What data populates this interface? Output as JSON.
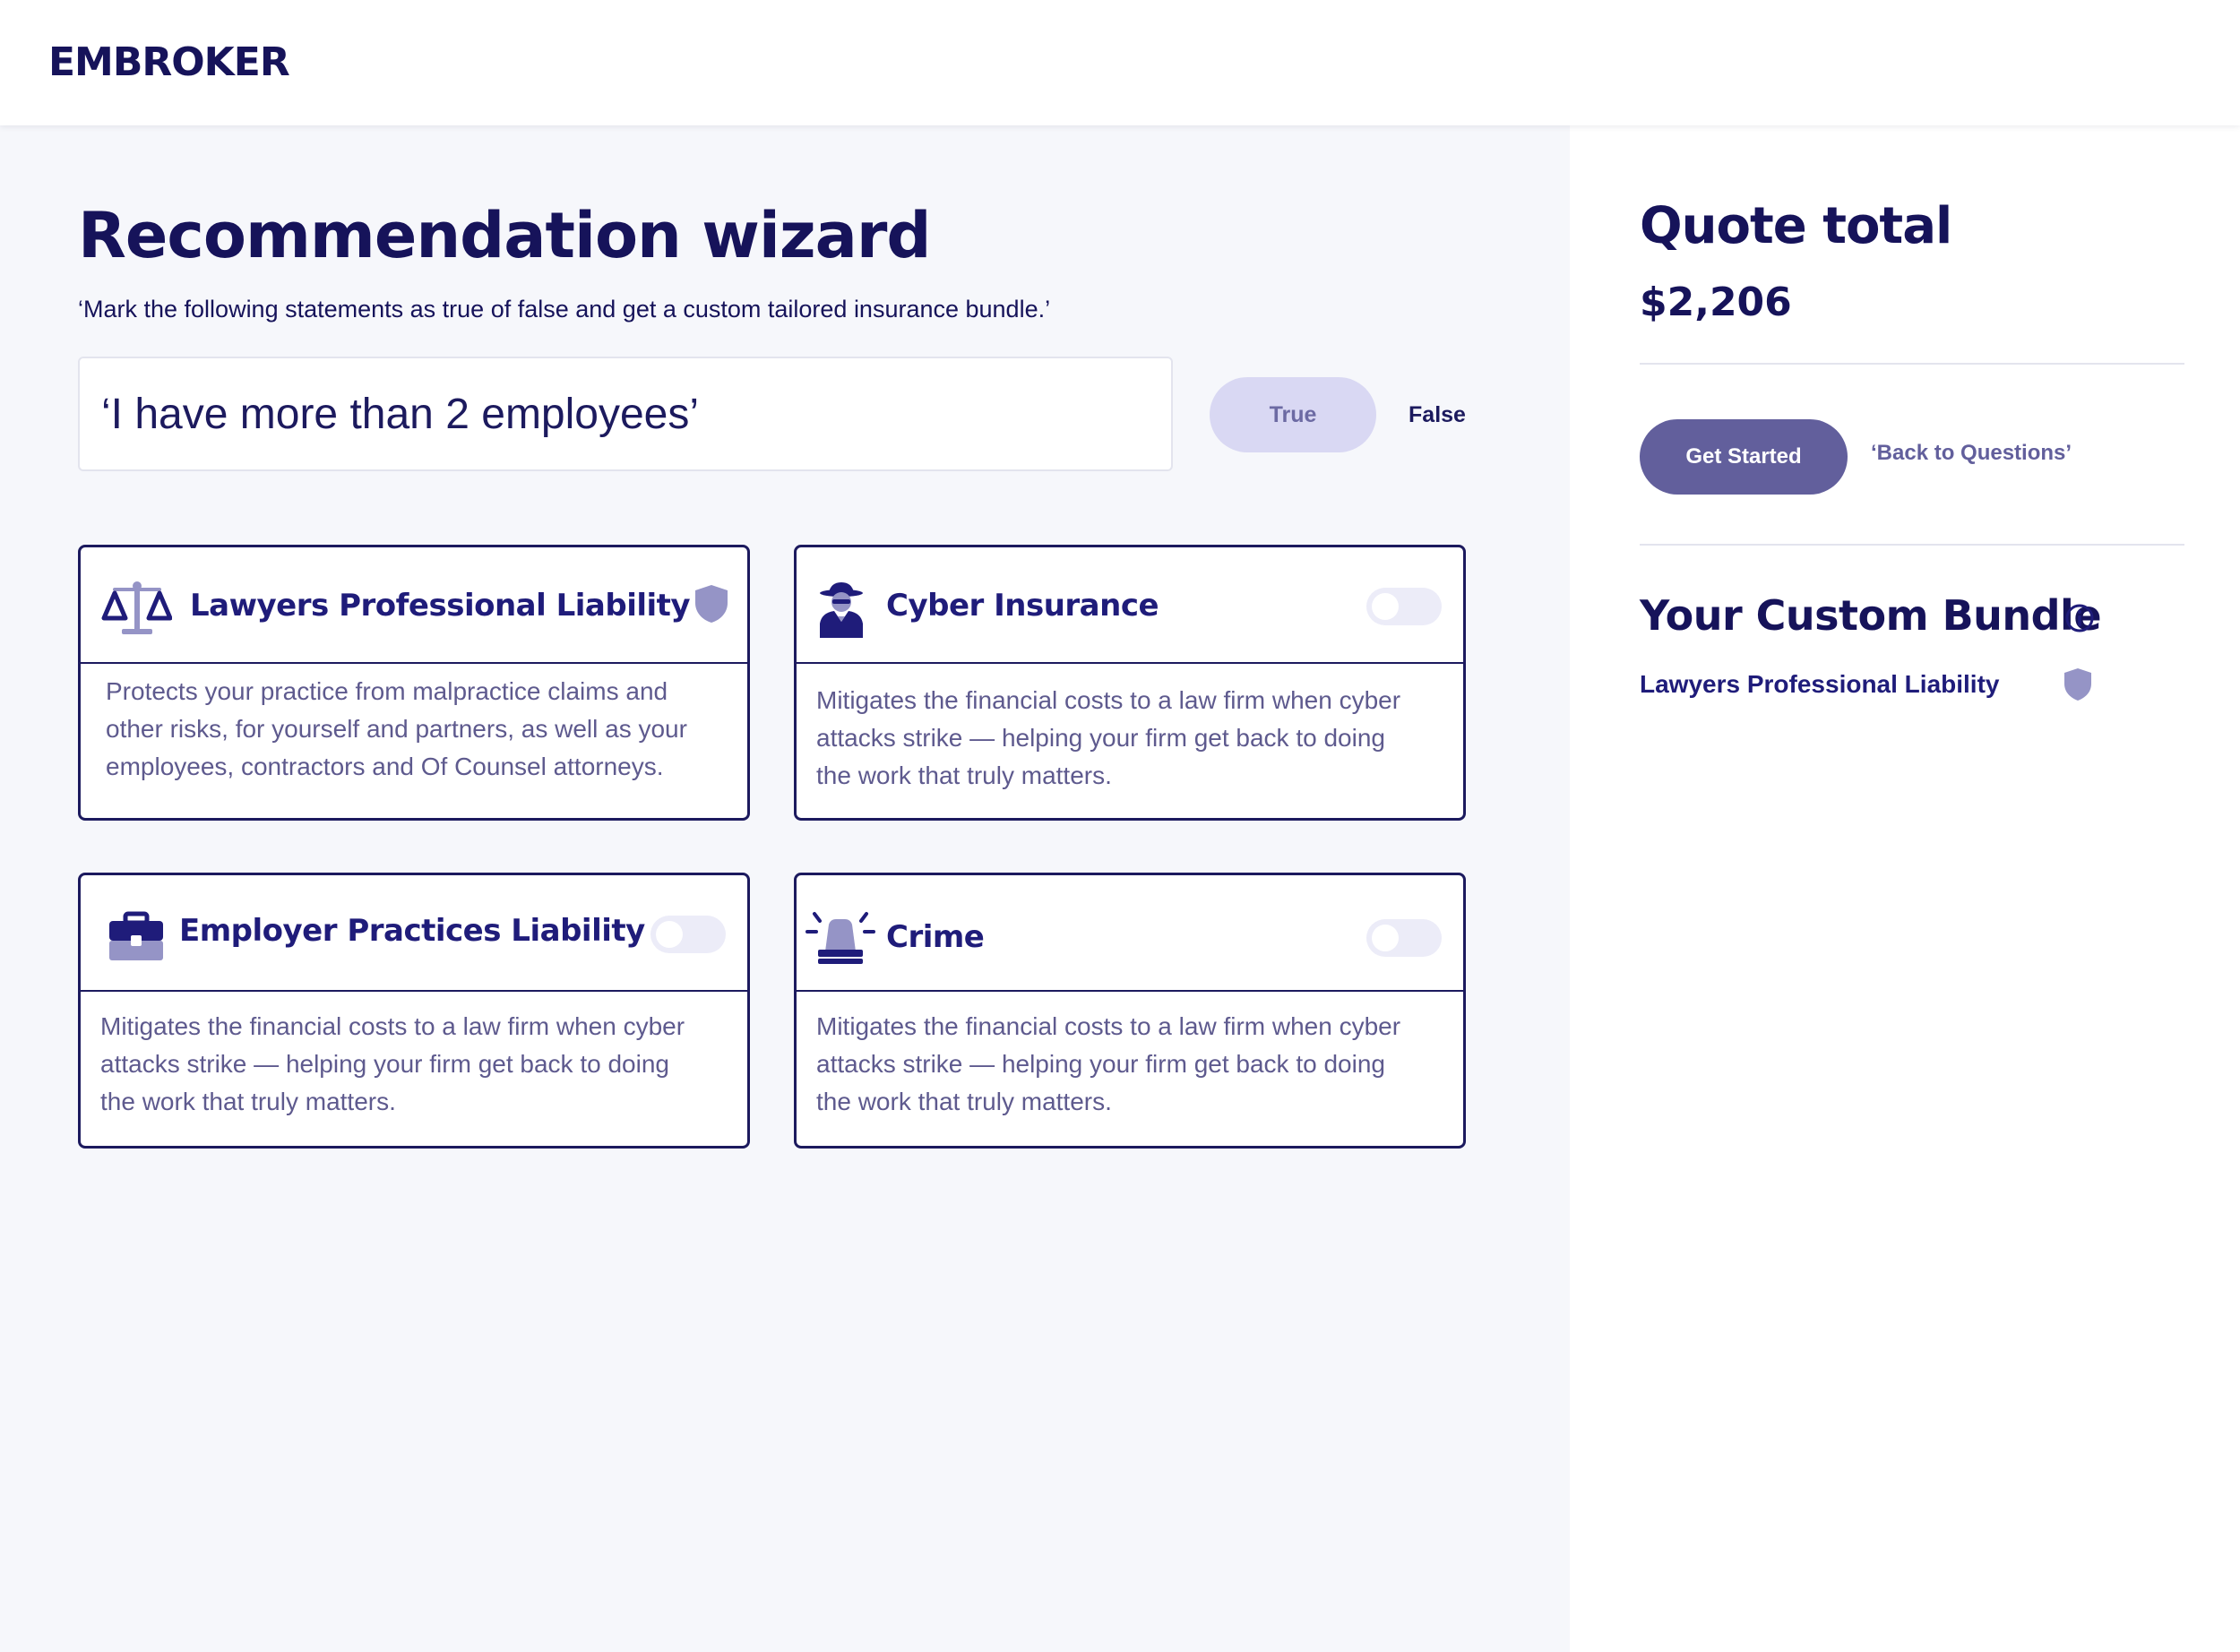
{
  "header": {
    "logo_text": "EMBROKER"
  },
  "wizard": {
    "title": "Recommendation wizard",
    "subtitle": "‘Mark the following statements as true of false and get a custom tailored insurance bundle.’",
    "statement": "‘I have more than 2 employees’",
    "true_label": "True",
    "false_label": "False"
  },
  "cards": [
    {
      "title": "Lawyers Professional Liability",
      "icon": "scales-icon",
      "status": "included-shield",
      "description": "Protects your practice from malpractice claims and other risks, for yourself and partners, as well as your employees, contractors and Of Counsel attorneys."
    },
    {
      "title": "Cyber Insurance",
      "icon": "spy-icon",
      "status": "toggle-off",
      "description": "Mitigates the financial costs to a law firm when cyber attacks strike — helping your firm get back to doing the work that truly matters."
    },
    {
      "title": "Employer Practices Liability",
      "icon": "briefcase-icon",
      "status": "toggle-off",
      "description": "Mitigates the financial costs to a law firm when cyber attacks strike — helping your firm get back to doing the work that truly matters."
    },
    {
      "title": "Crime",
      "icon": "siren-icon",
      "status": "toggle-off",
      "description": "Mitigates the financial costs to a law firm when cyber attacks strike — helping your firm get back to doing the work that truly matters."
    }
  ],
  "quote": {
    "title": "Quote total",
    "amount": "$2,206",
    "get_started_label": "Get Started",
    "back_label": "‘Back to Questions’"
  },
  "bundle": {
    "title": "Your Custom Bundle",
    "items": [
      {
        "label": "Lawyers Professional Liability",
        "icon": "shield-icon"
      }
    ]
  },
  "colors": {
    "brand_navy": "#16135a",
    "accent_purple": "#625f9c",
    "soft_lavender": "#d9d8f3",
    "shield": "#9594c6"
  }
}
